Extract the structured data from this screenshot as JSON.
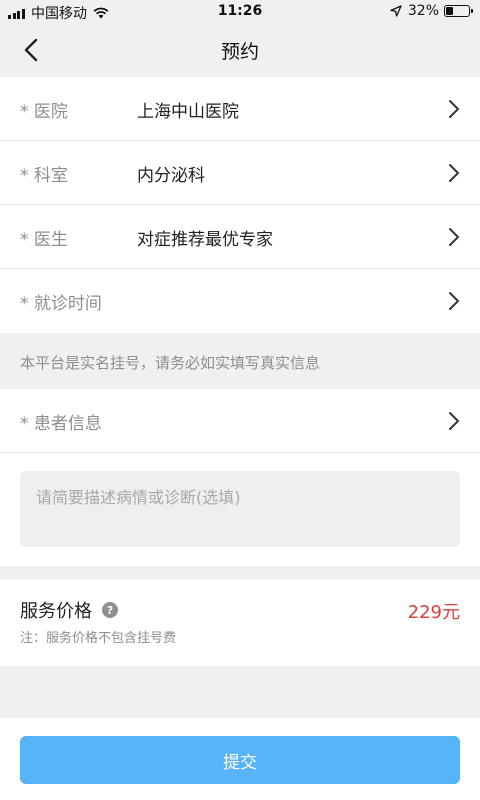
{
  "status_bar": {
    "carrier": "中国移动",
    "time": "11:26",
    "battery_percent": "32%",
    "battery_level": 0.32,
    "icons": [
      "signal-icon",
      "wifi-icon",
      "location-arrow-icon",
      "battery-icon"
    ]
  },
  "nav": {
    "title": "预约",
    "back_icon": "chevron-left-icon"
  },
  "form": {
    "rows": [
      {
        "label": "* 医院",
        "value": "上海中山医院"
      },
      {
        "label": "* 科室",
        "value": "内分泌科"
      },
      {
        "label": "* 医生",
        "value": "对症推荐最优专家"
      },
      {
        "label": "* 就诊时间",
        "value": ""
      }
    ],
    "notice": "本平台是实名挂号，请务必如实填写真实信息",
    "patient_row": {
      "label": "* 患者信息",
      "value": ""
    },
    "description": {
      "value": "",
      "placeholder": "请简要描述病情或诊断(选填)"
    }
  },
  "price": {
    "label": "服务价格",
    "value": "229元",
    "note": "注：服务价格不包含挂号费",
    "help_icon_glyph": "?"
  },
  "submit": {
    "label": "提交"
  },
  "colors": {
    "accent": "#58b4f8",
    "price": "#d9413d",
    "label_gray": "#8e8e93",
    "background": "#f0f0f0"
  }
}
